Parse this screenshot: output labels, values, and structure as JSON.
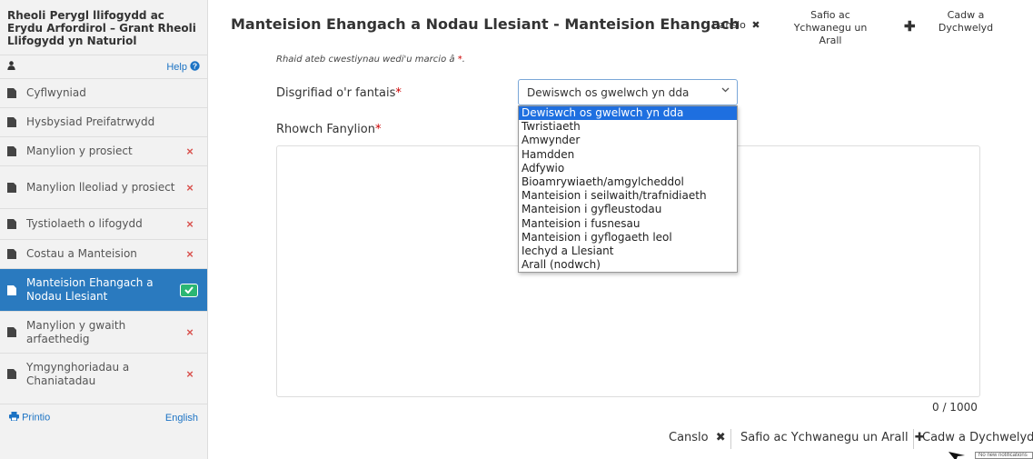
{
  "sidebar": {
    "title": "Rheoli Perygl llifogydd ac Erydu Arfordirol – Grant Rheoli Llifogydd yn Naturiol",
    "help_label": "Help",
    "items": [
      {
        "label": "Cyflwyniad",
        "status": "none"
      },
      {
        "label": "Hysbysiad Preifatrwydd",
        "status": "none"
      },
      {
        "label": "Manylion y prosiect",
        "status": "incomplete"
      },
      {
        "label": "Manylion lleoliad y prosiect",
        "status": "incomplete"
      },
      {
        "label": "Tystiolaeth o lifogydd",
        "status": "incomplete"
      },
      {
        "label": "Costau a Manteision",
        "status": "incomplete"
      },
      {
        "label": "Manteision Ehangach a Nodau Llesiant",
        "status": "complete"
      },
      {
        "label": "Manylion y gwaith arfaethedig",
        "status": "incomplete"
      },
      {
        "label": "Ymgynghoriadau a Chaniatadau",
        "status": "incomplete"
      }
    ],
    "print_label": "Printio",
    "language_label": "English"
  },
  "header": {
    "title": "Manteision Ehangach a Nodau Llesiant - Manteision Ehangach",
    "cancel_label": "Canslo",
    "save_add_label": "Safio ac Ychwanegu un Arall",
    "save_return_label": "Cadw a Dychwelyd"
  },
  "form": {
    "required_note": "Rhaid ateb cwestiynau wedi'u marcio â",
    "required_mark": "*",
    "field_description_label": "Disgrifiad o'r fantais",
    "field_details_label": "Rhowch Fanylion",
    "select_value": "Dewiswch os gwelwch yn dda",
    "options": [
      "Dewiswch os gwelwch yn dda",
      "Twristiaeth",
      "Amwynder",
      "Hamdden",
      "Adfywio",
      "Bioamrywiaeth/amgylcheddol",
      "Manteision i seilwaith/trafnidiaeth",
      "Manteision i gyfleustodau",
      "Manteision i fusnesau",
      "Manteision i gyflogaeth leol",
      "Iechyd a Llesiant",
      "Arall (nodwch)"
    ],
    "char_counter": "0 / 1000"
  },
  "footer": {
    "cancel_label": "Canslo",
    "save_add_label": "Safio ac Ychwanegu un Arall",
    "save_return_label": "Cadw a Dychwelyd",
    "notification_text": "No new notifications"
  },
  "colors": {
    "accent": "#2a7abf",
    "error": "#d9534f",
    "success": "#2bb673",
    "option_selected": "#1e6fe0"
  },
  "icons": [
    "user-icon",
    "question-circle-icon",
    "document-icon",
    "close-icon",
    "check-icon",
    "print-icon",
    "plus-icon",
    "upload-icon",
    "chevron-down-icon"
  ]
}
